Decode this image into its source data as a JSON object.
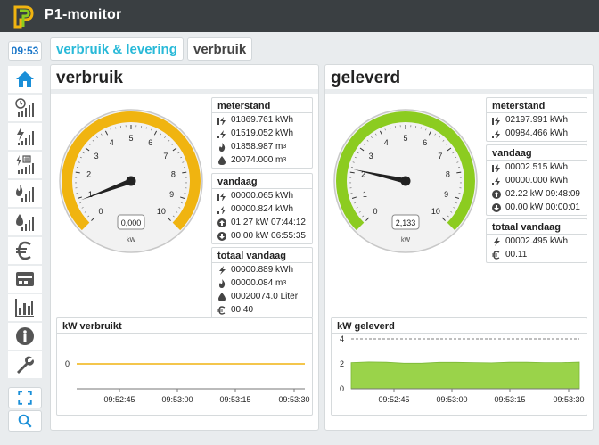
{
  "app": {
    "title": "P1-monitor"
  },
  "sidebar": {
    "time": "09:53",
    "items": [
      {
        "name": "home",
        "icon": "home-icon"
      },
      {
        "name": "clock-bars",
        "icon": "clock-bars-icon"
      },
      {
        "name": "power-bars",
        "icon": "power-bars-icon"
      },
      {
        "name": "phase-bars",
        "icon": "phase-bars-icon"
      },
      {
        "name": "gas-bars",
        "icon": "flame-bars-icon"
      },
      {
        "name": "water-bars",
        "icon": "water-bars-icon"
      },
      {
        "name": "euro",
        "icon": "euro-icon"
      },
      {
        "name": "meter",
        "icon": "meter-icon"
      },
      {
        "name": "stats",
        "icon": "bar-chart-icon"
      },
      {
        "name": "info",
        "icon": "info-icon"
      },
      {
        "name": "settings",
        "icon": "wrench-icon"
      },
      {
        "name": "fullscreen",
        "icon": "fullscreen-icon"
      },
      {
        "name": "search",
        "icon": "search-icon"
      }
    ]
  },
  "tabs": [
    {
      "label": "verbruik & levering"
    },
    {
      "label": "verbruik"
    }
  ],
  "left": {
    "title": "verbruik",
    "gauge": {
      "value": 0.9,
      "display": "0,000",
      "unit": "kW",
      "min": 0,
      "max": 10,
      "color": "#f0b410"
    },
    "meterstand": {
      "title": "meterstand",
      "rows": [
        {
          "icon": "tariff-high-icon",
          "text": "01869.761 kWh"
        },
        {
          "icon": "tariff-low-icon",
          "text": "01519.052 kWh"
        },
        {
          "icon": "flame-icon",
          "text": "01858.987 m",
          "sup": "3"
        },
        {
          "icon": "drop-icon",
          "text": "20074.000 m",
          "sup": "3"
        }
      ]
    },
    "vandaag": {
      "title": "vandaag",
      "rows": [
        {
          "icon": "tariff-high-icon",
          "text": "00000.065 kWh"
        },
        {
          "icon": "tariff-low-icon",
          "text": "00000.824 kWh"
        },
        {
          "icon": "arrow-up-icon",
          "text": "01.27 kW 07:44:12"
        },
        {
          "icon": "arrow-down-icon",
          "text": "00.00 kW 06:55:35"
        }
      ]
    },
    "totaal": {
      "title": "totaal vandaag",
      "rows": [
        {
          "icon": "bolt-icon",
          "text": "00000.889 kWh"
        },
        {
          "icon": "flame-icon",
          "text": "00000.084 m",
          "sup": "3"
        },
        {
          "icon": "drop-icon",
          "text": "00020074.0 Liter"
        },
        {
          "icon": "euro-icon",
          "text": "00.40"
        }
      ]
    },
    "chart_title": "kW verbruikt"
  },
  "right": {
    "title": "geleverd",
    "gauge": {
      "value": 2.133,
      "display": "2,133",
      "unit": "kW",
      "min": 0,
      "max": 10,
      "color": "#8ccc20"
    },
    "meterstand": {
      "title": "meterstand",
      "rows": [
        {
          "icon": "tariff-high-icon",
          "text": "02197.991 kWh"
        },
        {
          "icon": "tariff-low-icon",
          "text": "00984.466 kWh"
        }
      ]
    },
    "vandaag": {
      "title": "vandaag",
      "rows": [
        {
          "icon": "tariff-high-icon",
          "text": "00002.515 kWh"
        },
        {
          "icon": "tariff-low-icon",
          "text": "00000.000 kWh"
        },
        {
          "icon": "arrow-up-icon",
          "text": "02.22 kW 09:48:09"
        },
        {
          "icon": "arrow-down-icon",
          "text": "00.00 kW 00:00:01"
        }
      ]
    },
    "totaal": {
      "title": "totaal vandaag",
      "rows": [
        {
          "icon": "bolt-icon",
          "text": "00002.495 kWh"
        },
        {
          "icon": "euro-icon",
          "text": "00.11"
        }
      ]
    },
    "chart_title": "kW geleverd"
  },
  "chart_data": [
    {
      "type": "line",
      "title": "kW verbruikt",
      "x": [
        "09:52:45",
        "09:53:00",
        "09:53:15",
        "09:53:30"
      ],
      "y_ticks": [
        "0"
      ],
      "series": [
        {
          "values": [
            0,
            0,
            0,
            0,
            0,
            0,
            0,
            0
          ],
          "color": "#f0b410"
        }
      ],
      "ylim": [
        -1,
        1
      ]
    },
    {
      "type": "area",
      "title": "kW geleverd",
      "x": [
        "09:52:45",
        "09:53:00",
        "09:53:15",
        "09:53:30"
      ],
      "y_ticks": [
        "0",
        "2",
        "4"
      ],
      "series": [
        {
          "values": [
            2.1,
            2.15,
            2.13,
            2.05,
            2.05,
            2.12,
            2.12,
            2.1,
            2.08,
            2.13,
            2.13,
            2.1,
            2.1,
            2.14
          ],
          "color": "#9ad34a"
        }
      ],
      "ylim": [
        0,
        4
      ]
    }
  ]
}
